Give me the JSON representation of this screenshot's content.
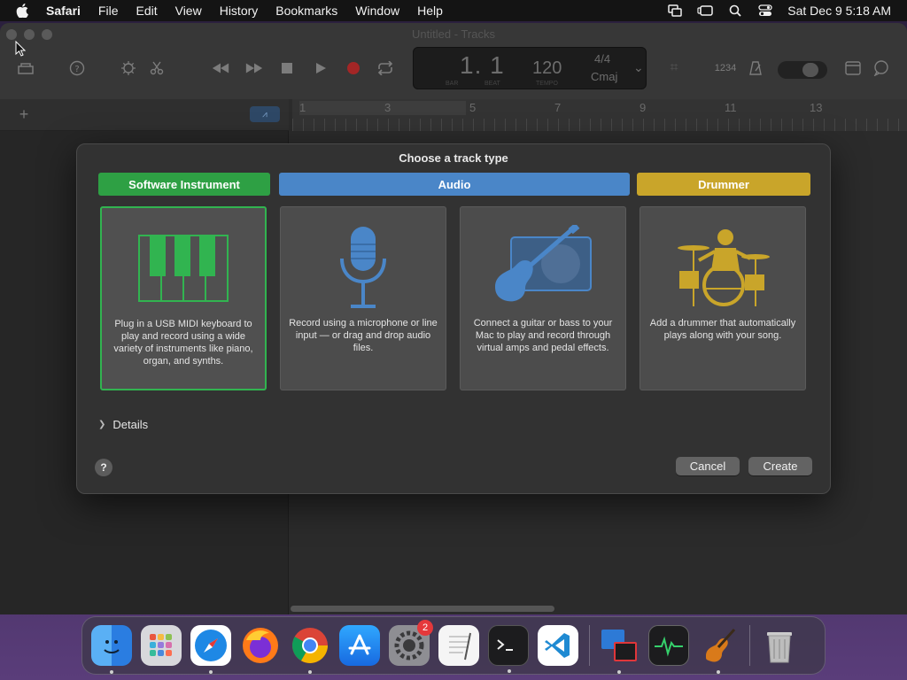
{
  "menubar": {
    "app_name": "Safari",
    "items": [
      "File",
      "Edit",
      "View",
      "History",
      "Bookmarks",
      "Window",
      "Help"
    ],
    "clock": "Sat Dec 9  5:18 AM"
  },
  "window": {
    "title": "Untitled - Tracks"
  },
  "lcd": {
    "bar": "1. 1",
    "bar_label": "BAR",
    "beat_label": "BEAT",
    "tempo": "120",
    "tempo_label": "TEMPO",
    "time_signature": "4/4",
    "key": "Cmaj"
  },
  "toolbar": {
    "count_in": "1234"
  },
  "ruler": {
    "bars": [
      "1",
      "3",
      "5",
      "7",
      "9",
      "11",
      "13"
    ]
  },
  "dialog": {
    "title": "Choose a track type",
    "categories": {
      "software": "Software Instrument",
      "audio": "Audio",
      "drummer": "Drummer"
    },
    "cards": [
      {
        "desc": "Plug in a USB MIDI keyboard to play and record using a wide variety of instruments like piano, organ, and synths."
      },
      {
        "desc": "Record using a microphone or line input — or drag and drop audio files."
      },
      {
        "desc": "Connect a guitar or bass to your Mac to play and record through virtual amps and pedal effects."
      },
      {
        "desc": "Add a drummer that automatically plays along with your song."
      }
    ],
    "details_label": "Details",
    "help_label": "?",
    "cancel_label": "Cancel",
    "create_label": "Create"
  },
  "dock": {
    "settings_badge": "2"
  },
  "colors": {
    "software": "#2ea044",
    "audio": "#4a86c8",
    "drummer": "#c9a52a"
  }
}
